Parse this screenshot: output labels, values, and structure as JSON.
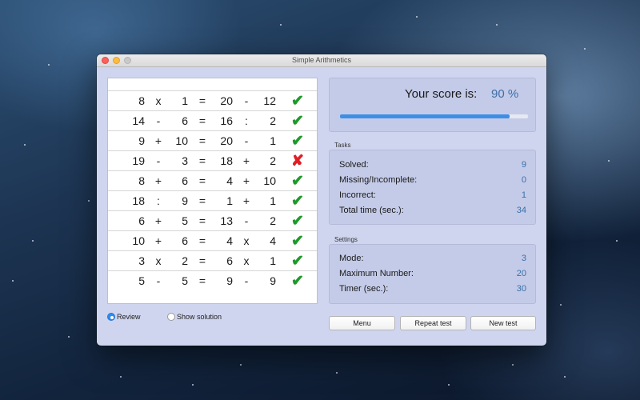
{
  "window": {
    "title": "Simple Arithmetics"
  },
  "problems": [
    {
      "a": "8",
      "op1": "x",
      "b": "1",
      "eq": "=",
      "c": "20",
      "op2": "-",
      "d": "12",
      "mark": "✔",
      "correct": true
    },
    {
      "a": "14",
      "op1": "-",
      "b": "6",
      "eq": "=",
      "c": "16",
      "op2": ":",
      "d": "2",
      "mark": "✔",
      "correct": true
    },
    {
      "a": "9",
      "op1": "+",
      "b": "10",
      "eq": "=",
      "c": "20",
      "op2": "-",
      "d": "1",
      "mark": "✔",
      "correct": true
    },
    {
      "a": "19",
      "op1": "-",
      "b": "3",
      "eq": "=",
      "c": "18",
      "op2": "+",
      "d": "2",
      "mark": "✘",
      "correct": false
    },
    {
      "a": "8",
      "op1": "+",
      "b": "6",
      "eq": "=",
      "c": "4",
      "op2": "+",
      "d": "10",
      "mark": "✔",
      "correct": true
    },
    {
      "a": "18",
      "op1": ":",
      "b": "9",
      "eq": "=",
      "c": "1",
      "op2": "+",
      "d": "1",
      "mark": "✔",
      "correct": true
    },
    {
      "a": "6",
      "op1": "+",
      "b": "5",
      "eq": "=",
      "c": "13",
      "op2": "-",
      "d": "2",
      "mark": "✔",
      "correct": true
    },
    {
      "a": "10",
      "op1": "+",
      "b": "6",
      "eq": "=",
      "c": "4",
      "op2": "x",
      "d": "4",
      "mark": "✔",
      "correct": true
    },
    {
      "a": "3",
      "op1": "x",
      "b": "2",
      "eq": "=",
      "c": "6",
      "op2": "x",
      "d": "1",
      "mark": "✔",
      "correct": true
    },
    {
      "a": "5",
      "op1": "-",
      "b": "5",
      "eq": "=",
      "c": "9",
      "op2": "-",
      "d": "9",
      "mark": "✔",
      "correct": true
    }
  ],
  "view_mode": {
    "review_label": "Review",
    "solution_label": "Show solution",
    "selected": "Review"
  },
  "score": {
    "label": "Your score is:",
    "value": "90 %",
    "progress_percent": 90
  },
  "tasks": {
    "title": "Tasks",
    "items": [
      {
        "label": "Solved:",
        "value": "9"
      },
      {
        "label": "Missing/Incomplete:",
        "value": "0"
      },
      {
        "label": "Incorrect:",
        "value": "1"
      },
      {
        "label": "Total time (sec.):",
        "value": "34"
      }
    ]
  },
  "settings": {
    "title": "Settings",
    "items": [
      {
        "label": "Mode:",
        "value": "3"
      },
      {
        "label": "Maximum Number:",
        "value": "20"
      },
      {
        "label": "Timer (sec.):",
        "value": "30"
      }
    ]
  },
  "buttons": {
    "menu": "Menu",
    "repeat": "Repeat test",
    "new": "New test"
  },
  "colors": {
    "correct": "#1e9a2b",
    "incorrect": "#e01e25",
    "accent": "#3d8fe5",
    "value_text": "#3a6fa8"
  }
}
